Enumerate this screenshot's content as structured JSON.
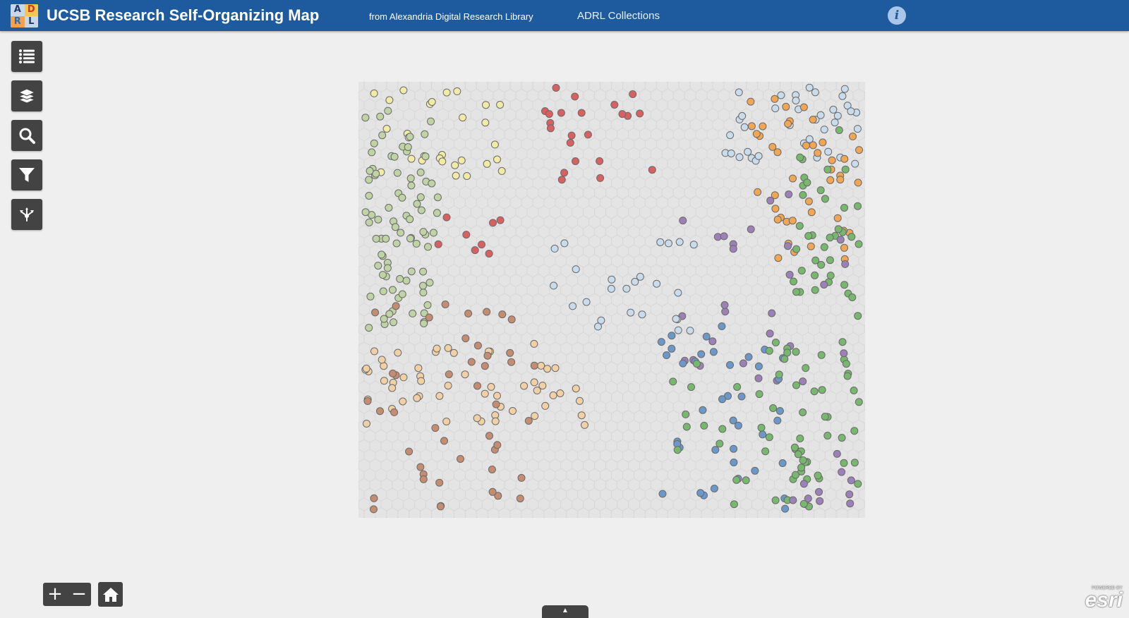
{
  "header": {
    "title": "UCSB Research Self-Organizing Map",
    "subtitle": "from Alexandria Digital Research Library",
    "collections_link": "ADRL Collections",
    "info_label": "i",
    "logo_letters": [
      "A",
      "D",
      "R",
      "L"
    ]
  },
  "toolbar": {
    "tools": [
      {
        "name": "list-icon"
      },
      {
        "name": "layers-icon"
      },
      {
        "name": "search-icon"
      },
      {
        "name": "filter-icon"
      },
      {
        "name": "share-icon"
      }
    ]
  },
  "colors": {
    "header": "#1e5a9e",
    "tool_bg": "#434343",
    "categories": {
      "cream": "#f2eba5",
      "sage": "#bfd3a4",
      "red": "#d86060",
      "purple": "#9c80b8",
      "lightblue": "#c8dcec",
      "orange": "#f0a653",
      "green": "#78b86e",
      "blue": "#6b98c8",
      "brown": "#c48c70",
      "tan": "#f2d0a6"
    }
  },
  "map": {
    "zoom_in_label": "+",
    "zoom_out_label": "−",
    "drawer_label": "▲",
    "attribution_small": "POWERED BY",
    "attribution_logo": "esri"
  }
}
